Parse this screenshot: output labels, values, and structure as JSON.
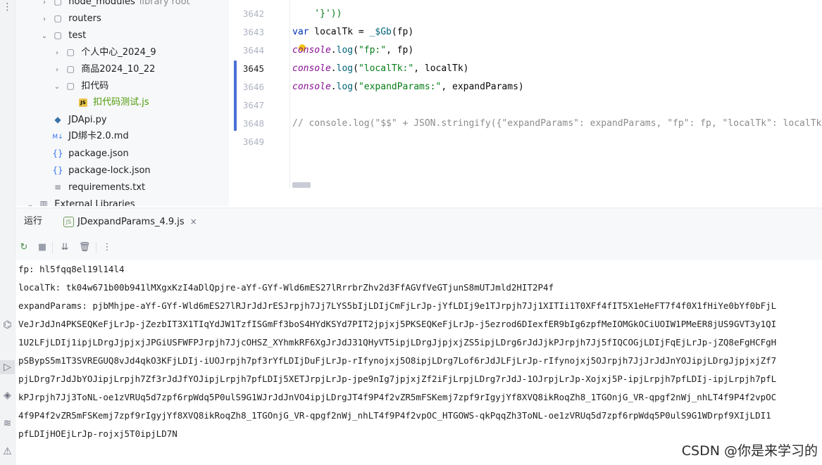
{
  "project_tree": {
    "items": [
      {
        "chevron": "›",
        "icon": "folder-icon",
        "name": "node_modules",
        "suffix": "library root"
      },
      {
        "chevron": "›",
        "icon": "folder-icon",
        "name": "routers"
      },
      {
        "chevron": "⌄",
        "icon": "folder-icon",
        "name": "test"
      },
      {
        "chevron": "›",
        "icon": "folder-icon",
        "name": "个人中心_2024_9"
      },
      {
        "chevron": "›",
        "icon": "folder-icon",
        "name": "商品2024_10_22"
      },
      {
        "chevron": "⌄",
        "icon": "folder-icon",
        "name": "扣代码"
      },
      {
        "chevron": "",
        "icon": "js-file-icon",
        "name": "扣代码测试.js"
      },
      {
        "chevron": "",
        "icon": "python-file-icon",
        "name": "JDApi.py"
      },
      {
        "chevron": "",
        "icon": "markdown-file-icon",
        "name": "JD绑卡2.0.md"
      },
      {
        "chevron": "",
        "icon": "json-file-icon",
        "name": "package.json"
      },
      {
        "chevron": "",
        "icon": "json-file-icon",
        "name": "package-lock.json"
      },
      {
        "chevron": "",
        "icon": "text-file-icon",
        "name": "requirements.txt"
      },
      {
        "chevron": "⌄",
        "icon": "library-icon",
        "name": "External Libraries"
      }
    ],
    "js_badge": "JS",
    "md_badge": "M↓"
  },
  "editor": {
    "lines": [
      {
        "num": "3642",
        "tokens": [
          {
            "t": "    '}'))",
            "c": "str"
          }
        ]
      },
      {
        "num": "3643",
        "tokens": [
          {
            "t": "var",
            "c": "kw"
          },
          {
            "t": " localTk = ",
            "c": "ident"
          },
          {
            "t": "_$Gb",
            "c": "fn"
          },
          {
            "t": "(fp)",
            "c": "ident"
          }
        ]
      },
      {
        "num": "3644",
        "tokens": [
          {
            "t": "console",
            "c": "glob"
          },
          {
            "t": ".",
            "c": "ident"
          },
          {
            "t": "log",
            "c": "fn"
          },
          {
            "t": "(",
            "c": "ident"
          },
          {
            "t": "\"fp:\"",
            "c": "str"
          },
          {
            "t": ", fp)",
            "c": "ident"
          }
        ]
      },
      {
        "num": "3645",
        "tokens": [
          {
            "t": "console",
            "c": "glob"
          },
          {
            "t": ".",
            "c": "ident"
          },
          {
            "t": "log",
            "c": "fn"
          },
          {
            "t": "(",
            "c": "ident"
          },
          {
            "t": "\"localTk:\"",
            "c": "str"
          },
          {
            "t": ", localTk)",
            "c": "ident"
          }
        ]
      },
      {
        "num": "3646",
        "tokens": [
          {
            "t": "console",
            "c": "glob"
          },
          {
            "t": ".",
            "c": "ident"
          },
          {
            "t": "log",
            "c": "fn"
          },
          {
            "t": "(",
            "c": "ident"
          },
          {
            "t": "\"expandParams:\"",
            "c": "str"
          },
          {
            "t": ", expandParams)",
            "c": "ident"
          }
        ]
      },
      {
        "num": "3647",
        "tokens": []
      },
      {
        "num": "3648",
        "tokens": [
          {
            "t": "// console.log(\"$$\" + JSON.stringify({\"expandParams\": expandParams, \"fp\": fp, \"localTk\": localTk}))",
            "c": "cmt"
          }
        ]
      },
      {
        "num": "3649",
        "tokens": []
      }
    ],
    "current_line": "3645"
  },
  "run_panel": {
    "tab_run": "运行",
    "tab_file": "JDexpandParams_4.9.js",
    "node_badge": "JS",
    "close": "×"
  },
  "console": {
    "lines": [
      "fp: hl5fqq8el19l14l4",
      "localTk: tk04w671b00b941lMXgxKzI4aDlQpjre-aYf-GYf-Wld6mES27lRrrbrZhv2d3FfAGVfVeGTjunS8mUTJmld2HIT2P4f",
      "expandParams: pjbMhjpe-aYf-GYf-Wld6mES27lRJrJdJrESJrpjh7Jj7LYS5bIjLDIjCmFjLrJp-jYfLDIj9e1TJrpjh7Jj1XITIi1T0XFf4fIT5X1eHeFT7f4f0X1fHiYe0bYf0bFjL",
      "VeJrJdJn4PKSEQKeFjLrJp-jZezbIT3X1TIqYdJW1TzfISGmFf3boS4HYdKSYd7PIT2jpjxj5PKSEQKeFjLrJp-j5ezrod6DIexfER9bIg6zpfMeIOMGkOCiUOIW1PMeER8jUS9GVT3y1QI",
      "1U2LFjLDIj1ipjLDrgJjpjxjJPGiUSFWFPJrpjh7JjcOHSZ_XYhmkRF6XgJrJdJ31QHyVT5ipjLDrgJjpjxjZS5ipjLDrg6rJdJjkPJrpjh7Jj5fIQCOGjLDIjFqEjLrJp-jZQ8eFgHCFgH",
      "pSBypS5m1T3SVREGUQ8vJd4qkO3KFjLDIj-iUOJrpjh7pf3rYfLDIjDuFjLrJp-rIfynojxj5O8ipjLDrg7Lof6rJdJLFjLrJp-rIfynojxj5OJrpjh7JjJrJdJnYOJipjLDrgJjpjxjZf7",
      "pjLDrg7rJdJbYOJipjLrpjh7Zf3rJdJfYOJipjLrpjh7pfLDIj5XETJrpjLrJp-jpe9nIg7jpjxjZf2iFjLrpjLDrg7rJdJ-1OJrpjLrJp-Xojxj5P-ipjLrpjh7pfLDIj-ipjLrpjh7pfL",
      "kPJrpjh7Jj3ToNL-oe1zVRUq5d7zpf6rpWdq5P0ulS9G1WJrJdJnVO4ipjLDrgJT4f9P4f2vZR5mFSKemj7zpf9rIgyjYf8XVQ8ikRoqZh8_1TGOnjG_VR-qpgf2nWj_nhLT4f9P4f2vpOC",
      "4f9P4f2vZR5mFSKemj7zpf9rIgyjYf8XVQ8ikRoqZh8_1TGOnjG_VR-qpgf2nWj_nhLT4f9P4f2vpOC_HTGOWS-qkPqqZh3ToNL-oe1zVRUq5d7zpf6rpWdq5P0ulS9G1WDrpf9XIjLDI1",
      "pfLDIjHOEjLrJp-rojxj5T0ipjLD7N"
    ]
  },
  "watermark": "CSDN @你是来学习的"
}
